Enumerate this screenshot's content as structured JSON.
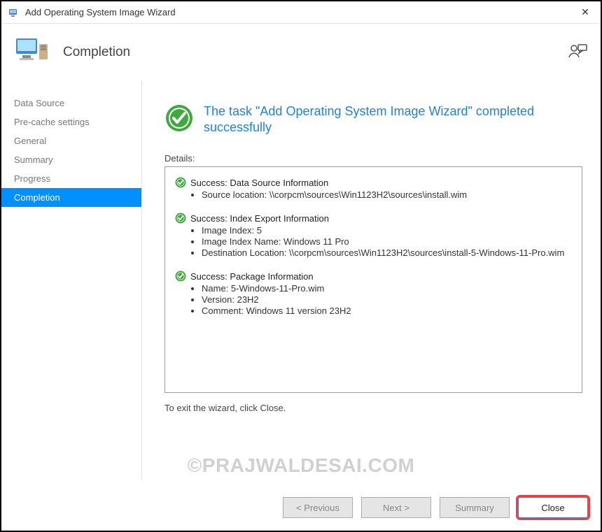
{
  "window": {
    "title": "Add Operating System Image Wizard"
  },
  "header": {
    "title": "Completion"
  },
  "sidebar": {
    "items": [
      {
        "label": "Data Source"
      },
      {
        "label": "Pre-cache settings"
      },
      {
        "label": "General"
      },
      {
        "label": "Summary"
      },
      {
        "label": "Progress"
      },
      {
        "label": "Completion"
      }
    ],
    "activeIndex": 5
  },
  "main": {
    "statusMessage": "The task \"Add Operating System Image Wizard\" completed successfully",
    "detailsLabel": "Details:",
    "exitNote": "To exit the wizard, click Close.",
    "groups": [
      {
        "title": "Success: Data Source Information",
        "items": [
          "Source location: \\\\corpcm\\sources\\Win1123H2\\sources\\install.wim"
        ]
      },
      {
        "title": "Success: Index Export Information",
        "items": [
          "Image Index: 5",
          "Image Index Name: Windows 11 Pro",
          "Destination Location: \\\\corpcm\\sources\\Win1123H2\\sources\\install-5-Windows-11-Pro.wim"
        ]
      },
      {
        "title": "Success: Package Information",
        "items": [
          "Name: 5-Windows-11-Pro.wim",
          "Version: 23H2",
          "Comment: Windows 11 version 23H2"
        ]
      }
    ]
  },
  "buttons": {
    "previous": "< Previous",
    "next": "Next >",
    "summary": "Summary",
    "close": "Close"
  },
  "watermark": "©PRAJWALDESAI.COM"
}
